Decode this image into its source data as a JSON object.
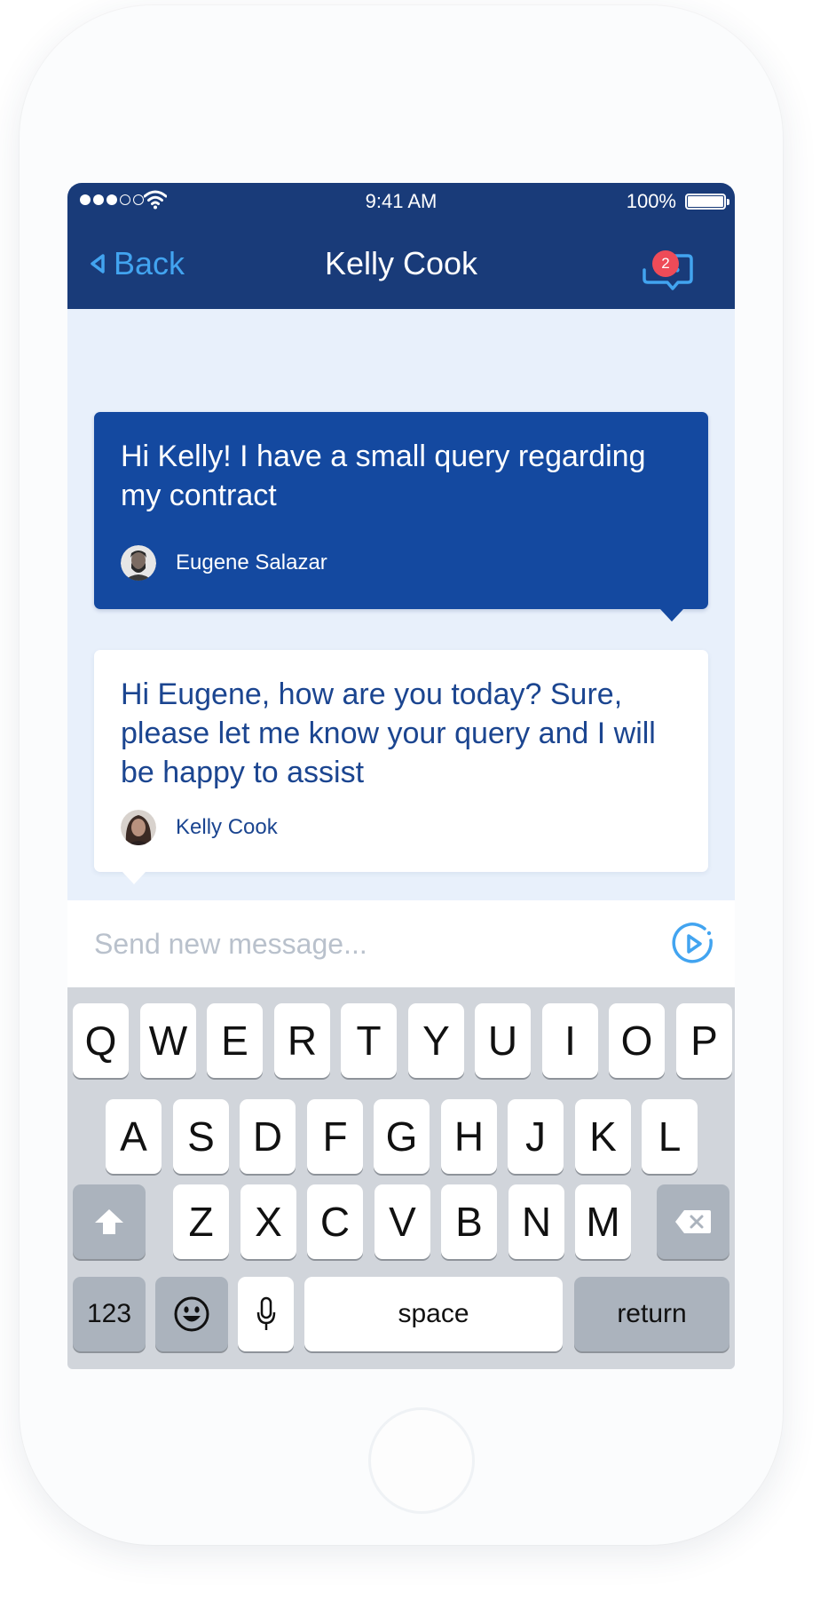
{
  "status_bar": {
    "time": "9:41 AM",
    "battery": "100%"
  },
  "nav": {
    "back_label": "Back",
    "title": "Kelly Cook",
    "badge_count": "2"
  },
  "messages": [
    {
      "text": "Hi Kelly! I have a small query regarding my contract",
      "sender": "Eugene Salazar",
      "direction": "outgoing"
    },
    {
      "text": "Hi Eugene, how are you today? Sure, please let me know your query and I will be happy to assist",
      "sender": "Kelly Cook",
      "direction": "incoming"
    }
  ],
  "compose": {
    "placeholder": "Send new message..."
  },
  "keyboard": {
    "row1": [
      "Q",
      "W",
      "E",
      "R",
      "T",
      "Y",
      "U",
      "I",
      "O",
      "P"
    ],
    "row2": [
      "A",
      "S",
      "D",
      "F",
      "G",
      "H",
      "J",
      "K",
      "L"
    ],
    "row3": [
      "Z",
      "X",
      "C",
      "V",
      "B",
      "N",
      "M"
    ],
    "numbers_label": "123",
    "space_label": "space",
    "return_label": "return"
  },
  "icons": {
    "back": "back-arrow-icon",
    "chat": "chat-bubble-icon",
    "send": "send-play-icon",
    "shift": "shift-icon",
    "delete": "backspace-icon",
    "emoji": "emoji-icon",
    "mic": "microphone-icon"
  },
  "colors": {
    "header": "#193b79",
    "accent": "#42a4f0",
    "outgoing_bubble": "#1449a0",
    "incoming_text": "#1b4590",
    "chat_background": "#e8f0fb",
    "badge": "#ee4b58"
  }
}
